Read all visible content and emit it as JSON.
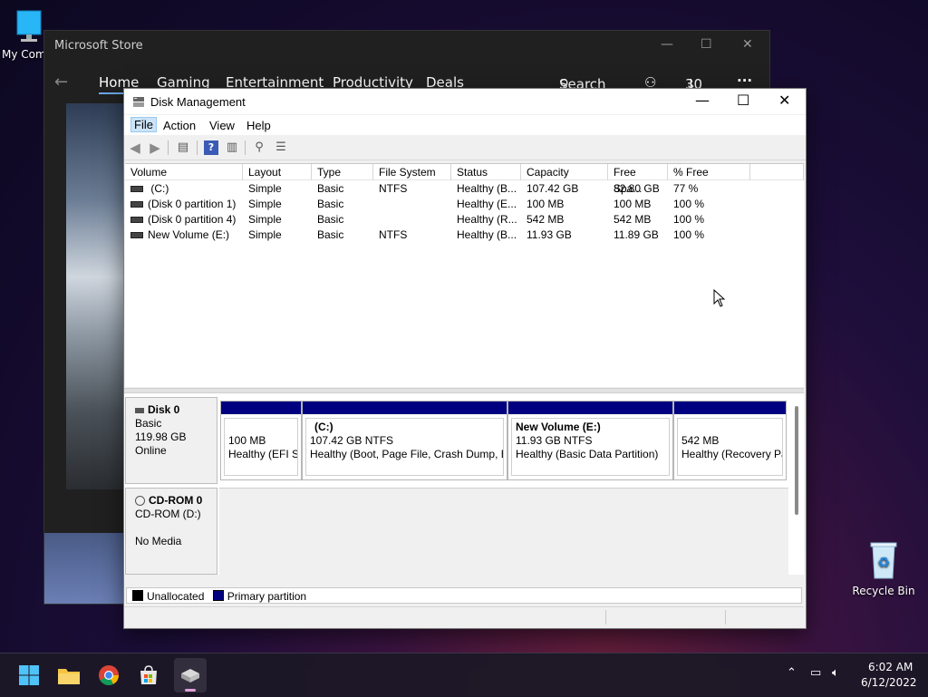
{
  "desktop": {
    "my_computer_label": "My Com",
    "recycle_bin_label": "Recycle Bin"
  },
  "store": {
    "title": "Microsoft Store",
    "nav": [
      "Home",
      "Gaming",
      "Entertainment",
      "Productivity",
      "Deals"
    ],
    "search_label": "Search",
    "downloads_count": "30",
    "more": "···"
  },
  "dm": {
    "title": "Disk Management",
    "menu": [
      "File",
      "Action",
      "View",
      "Help"
    ],
    "columns": [
      "Volume",
      "Layout",
      "Type",
      "File System",
      "Status",
      "Capacity",
      "Free Spa...",
      "% Free"
    ],
    "volumes": [
      {
        "volume": " (C:)",
        "layout": "Simple",
        "type": "Basic",
        "fs": "NTFS",
        "status": "Healthy (B...",
        "capacity": "107.42 GB",
        "free": "82.80 GB",
        "pct": "77 %"
      },
      {
        "volume": "(Disk 0 partition 1)",
        "layout": "Simple",
        "type": "Basic",
        "fs": "",
        "status": "Healthy (E...",
        "capacity": "100 MB",
        "free": "100 MB",
        "pct": "100 %"
      },
      {
        "volume": "(Disk 0 partition 4)",
        "layout": "Simple",
        "type": "Basic",
        "fs": "",
        "status": "Healthy (R...",
        "capacity": "542 MB",
        "free": "542 MB",
        "pct": "100 %"
      },
      {
        "volume": "New Volume (E:)",
        "layout": "Simple",
        "type": "Basic",
        "fs": "NTFS",
        "status": "Healthy (B...",
        "capacity": "11.93 GB",
        "free": "11.89 GB",
        "pct": "100 %"
      }
    ],
    "disk0": {
      "name": "Disk 0",
      "kind": "Basic",
      "size": "119.98 GB",
      "state": "Online",
      "partitions": [
        {
          "name": "",
          "size": "100 MB",
          "status": "Healthy (EFI Sy"
        },
        {
          "name": "(C:)",
          "size": "107.42 GB NTFS",
          "status": "Healthy (Boot, Page File, Crash Dump, B"
        },
        {
          "name": "New Volume  (E:)",
          "size": "11.93 GB NTFS",
          "status": "Healthy (Basic Data Partition)"
        },
        {
          "name": "",
          "size": "542 MB",
          "status": "Healthy (Recovery Pa"
        }
      ]
    },
    "cdrom": {
      "name": "CD-ROM 0",
      "drive": "CD-ROM (D:)",
      "media": "No Media"
    },
    "legend": {
      "unallocated": "Unallocated",
      "primary": "Primary partition"
    }
  },
  "taskbar": {
    "time": "6:02 AM",
    "date": "6/12/2022"
  },
  "colors": {
    "primary_partition": "#000080",
    "unallocated": "#000000",
    "store_bg": "#202020"
  }
}
